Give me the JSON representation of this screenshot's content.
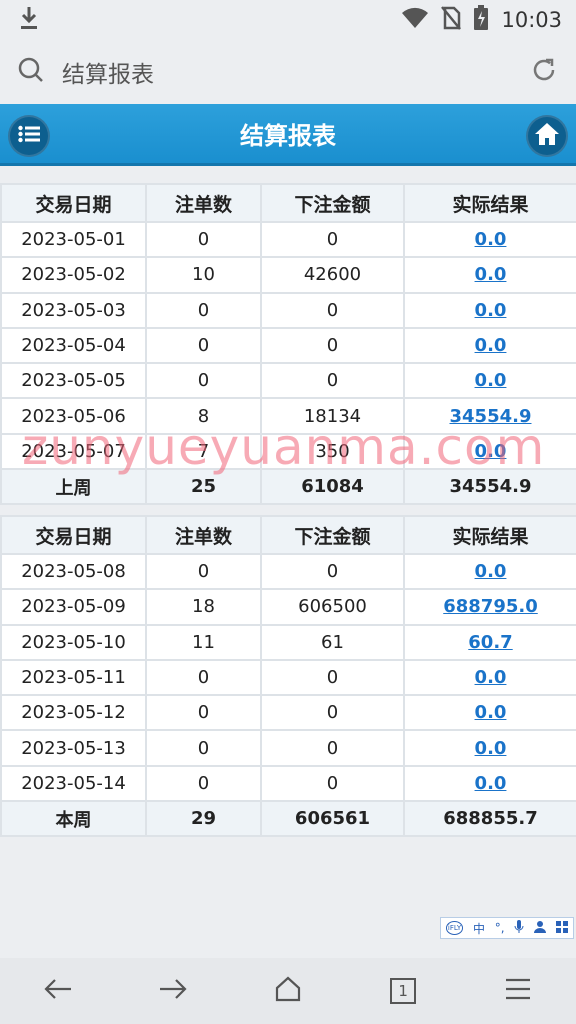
{
  "status": {
    "time": "10:03"
  },
  "address": {
    "text": "结算报表"
  },
  "header": {
    "title": "结算报表"
  },
  "tables": [
    {
      "columns": [
        "交易日期",
        "注单数",
        "下注金额",
        "实际结果"
      ],
      "rows": [
        [
          "2023-05-01",
          "0",
          "0",
          "0.0"
        ],
        [
          "2023-05-02",
          "10",
          "42600",
          "0.0"
        ],
        [
          "2023-05-03",
          "0",
          "0",
          "0.0"
        ],
        [
          "2023-05-04",
          "0",
          "0",
          "0.0"
        ],
        [
          "2023-05-05",
          "0",
          "0",
          "0.0"
        ],
        [
          "2023-05-06",
          "8",
          "18134",
          "34554.9"
        ],
        [
          "2023-05-07",
          "7",
          "350",
          "0.0"
        ]
      ],
      "total": [
        "上周",
        "25",
        "61084",
        "34554.9"
      ]
    },
    {
      "columns": [
        "交易日期",
        "注单数",
        "下注金额",
        "实际结果"
      ],
      "rows": [
        [
          "2023-05-08",
          "0",
          "0",
          "0.0"
        ],
        [
          "2023-05-09",
          "18",
          "606500",
          "688795.0"
        ],
        [
          "2023-05-10",
          "11",
          "61",
          "60.7"
        ],
        [
          "2023-05-11",
          "0",
          "0",
          "0.0"
        ],
        [
          "2023-05-12",
          "0",
          "0",
          "0.0"
        ],
        [
          "2023-05-13",
          "0",
          "0",
          "0.0"
        ],
        [
          "2023-05-14",
          "0",
          "0",
          "0.0"
        ]
      ],
      "total": [
        "本周",
        "29",
        "606561",
        "688855.7"
      ]
    }
  ],
  "watermark": "zunyueyuanma.com",
  "ime": {
    "logo": "iFLY",
    "lang": "中"
  },
  "nav": {
    "tab_count": "1"
  }
}
